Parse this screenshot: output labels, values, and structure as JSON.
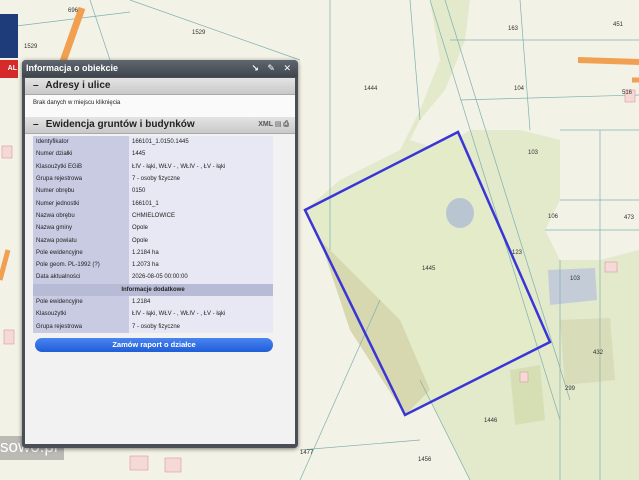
{
  "map": {
    "parcel_labels": [
      {
        "id": "l1",
        "text": "1529"
      },
      {
        "id": "l2",
        "text": "696"
      },
      {
        "id": "l3",
        "text": "1529"
      },
      {
        "id": "l4",
        "text": "163"
      },
      {
        "id": "l5",
        "text": "451"
      },
      {
        "id": "l6",
        "text": "1444"
      },
      {
        "id": "l7",
        "text": "104"
      },
      {
        "id": "l8",
        "text": "516"
      },
      {
        "id": "l9",
        "text": "103"
      },
      {
        "id": "l10",
        "text": "106"
      },
      {
        "id": "l11",
        "text": "473"
      },
      {
        "id": "l12",
        "text": "1445"
      },
      {
        "id": "l13",
        "text": "123"
      },
      {
        "id": "l14",
        "text": "103"
      },
      {
        "id": "l15",
        "text": "432"
      },
      {
        "id": "l16",
        "text": "299"
      },
      {
        "id": "l17",
        "text": "1446"
      },
      {
        "id": "l18",
        "text": "1477"
      },
      {
        "id": "l19",
        "text": "1456"
      }
    ],
    "selection_color": "#3a35d6",
    "watermark": "sowo.pl",
    "logo_text": "AL"
  },
  "panel": {
    "title": "Informacja o obiekcie",
    "title_icons": "↘ ✎ ✕",
    "sections": {
      "address": {
        "toggle": "–",
        "title": "Adresy i ulice",
        "text": "Brak danych w miejscu kliknięcia"
      },
      "egib": {
        "toggle": "–",
        "title": "Ewidencja gruntów i budynków",
        "icons": "XML ▤ ⎙"
      }
    },
    "attributes": [
      {
        "key": "Identyfikator",
        "value": "166101_1.0150.1445"
      },
      {
        "key": "Numer działki",
        "value": "1445"
      },
      {
        "key": "Klasoużytki EGiB",
        "value": "ŁIV - łąki, WŁV - , WŁIV - , ŁV - łąki"
      },
      {
        "key": "Grupa rejestrowa",
        "value": "7 - osoby fizyczne"
      },
      {
        "key": "Numer obrębu",
        "value": "0150"
      },
      {
        "key": "Numer jednostki",
        "value": "166101_1"
      },
      {
        "key": "Nazwa obrębu",
        "value": "CHMIELOWICE"
      },
      {
        "key": "Nazwa gminy",
        "value": "Opole"
      },
      {
        "key": "Nazwa powiatu",
        "value": "Opole"
      },
      {
        "key": "Pole ewidencyjne",
        "value": "1.2184 ha"
      },
      {
        "key": "Pole geom. PL-1992 (?)",
        "value": "1.2073 ha"
      },
      {
        "key": "Data aktualności",
        "value": "2026-08-05 00:00:00"
      }
    ],
    "additional_header": "Informacje dodatkowe",
    "additional": [
      {
        "key": "Pole ewidencyjne",
        "value": "1.2184"
      },
      {
        "key": "Klasoużytki",
        "value": "ŁIV - łąki, WŁV - , WŁIV - , ŁV - łąki"
      },
      {
        "key": "Grupa rejestrowa",
        "value": "7 - osoby fizyczne"
      }
    ],
    "order_button": "Zamów raport o działce"
  }
}
